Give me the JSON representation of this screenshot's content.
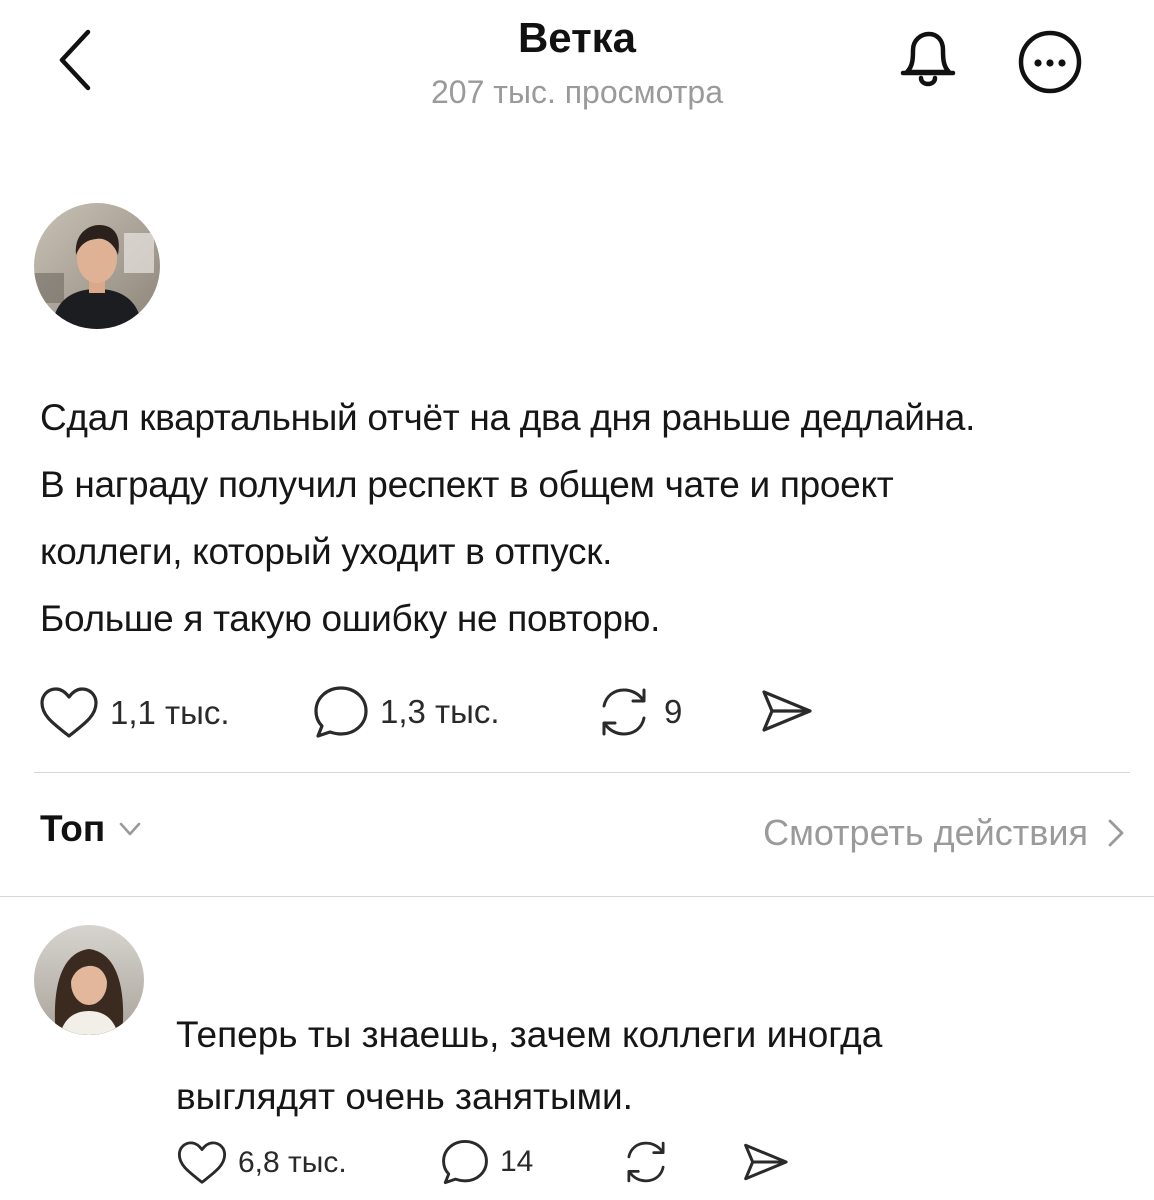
{
  "header": {
    "title": "Ветка",
    "subtitle": "207 тыс. просмотра"
  },
  "post": {
    "lines": [
      "Сдал квартальный отчёт на два дня раньше дедлайна.",
      "В награду получил респект в общем чате и проект",
      "коллеги, который уходит в отпуск.",
      "Больше я такую ошибку не повторю."
    ],
    "likes": "1,1 тыс.",
    "comments": "1,3 тыс.",
    "reposts": "9"
  },
  "sort": {
    "label": "Топ",
    "view_activity": "Смотреть действия"
  },
  "reply": {
    "lines": [
      "Теперь ты знаешь, зачем коллеги иногда",
      "выглядят очень занятыми."
    ],
    "likes": "6,8 тыс.",
    "comments": "14"
  },
  "icons": {
    "back": "chevron-left-icon",
    "bell": "bell-icon",
    "more": "more-circle-icon",
    "like": "heart-icon",
    "comment": "comment-bubble-icon",
    "repost": "repost-icon",
    "share": "send-icon"
  },
  "colors": {
    "text": "#111111",
    "muted": "#9a9a9a",
    "divider": "#d8d8d8",
    "background": "#ffffff"
  }
}
